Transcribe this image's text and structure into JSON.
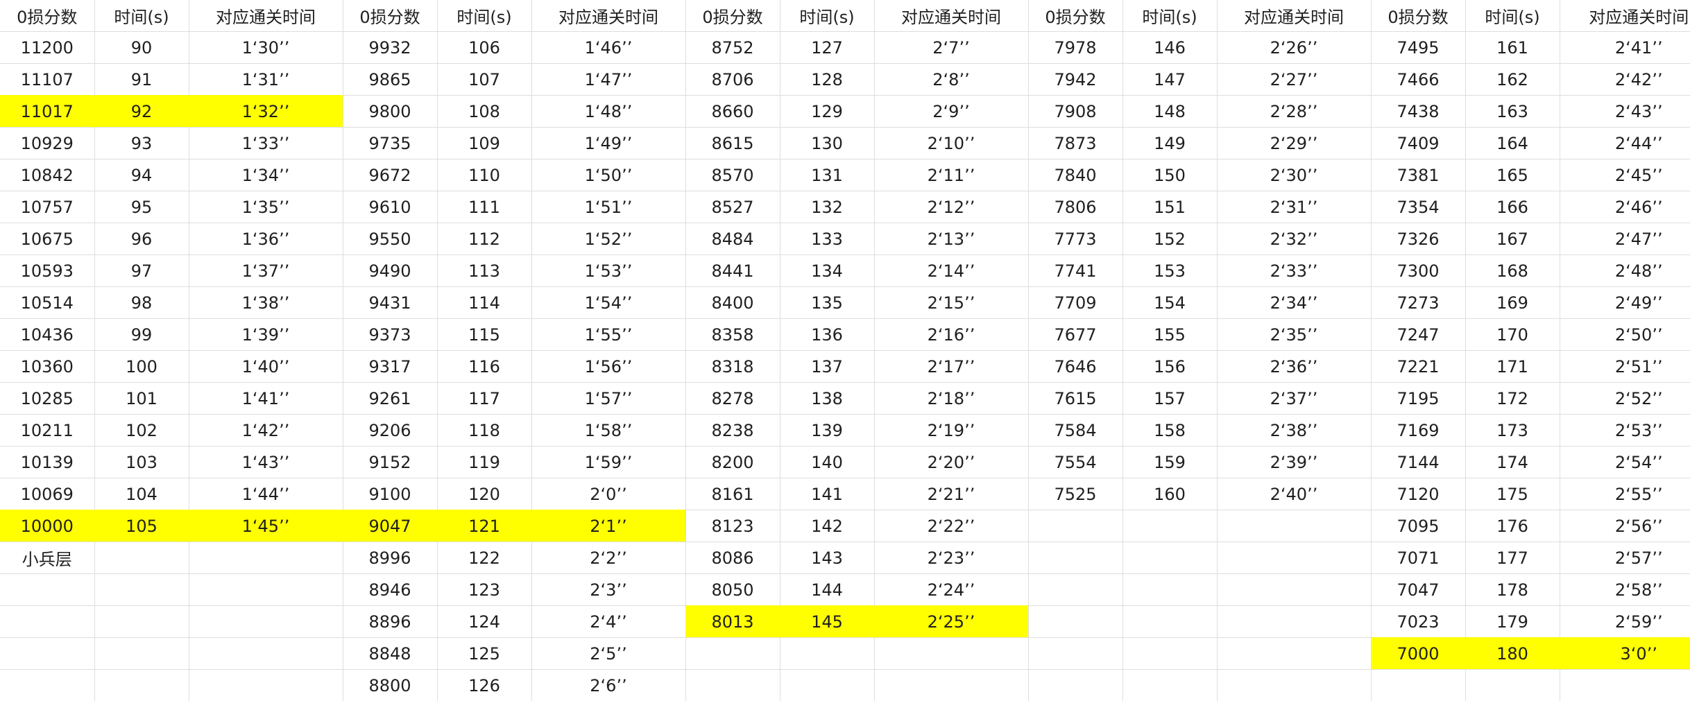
{
  "headers": [
    "0损分数",
    "时间(s)",
    "对应通关时间"
  ],
  "note": "小兵层",
  "highlight_color": "#ffff00",
  "groups": [
    {
      "highlighted_rows": [
        2,
        15
      ],
      "rows": [
        [
          "11200",
          "90",
          "1‘30’’"
        ],
        [
          "11107",
          "91",
          "1‘31’’"
        ],
        [
          "11017",
          "92",
          "1‘32’’"
        ],
        [
          "10929",
          "93",
          "1‘33’’"
        ],
        [
          "10842",
          "94",
          "1‘34’’"
        ],
        [
          "10757",
          "95",
          "1‘35’’"
        ],
        [
          "10675",
          "96",
          "1‘36’’"
        ],
        [
          "10593",
          "97",
          "1‘37’’"
        ],
        [
          "10514",
          "98",
          "1‘38’’"
        ],
        [
          "10436",
          "99",
          "1‘39’’"
        ],
        [
          "10360",
          "100",
          "1‘40’’"
        ],
        [
          "10285",
          "101",
          "1‘41’’"
        ],
        [
          "10211",
          "102",
          "1‘42’’"
        ],
        [
          "10139",
          "103",
          "1‘43’’"
        ],
        [
          "10069",
          "104",
          "1‘44’’"
        ],
        [
          "10000",
          "105",
          "1‘45’’"
        ]
      ]
    },
    {
      "highlighted_rows": [
        15
      ],
      "rows": [
        [
          "9932",
          "106",
          "1‘46’’"
        ],
        [
          "9865",
          "107",
          "1‘47’’"
        ],
        [
          "9800",
          "108",
          "1‘48’’"
        ],
        [
          "9735",
          "109",
          "1‘49’’"
        ],
        [
          "9672",
          "110",
          "1‘50’’"
        ],
        [
          "9610",
          "111",
          "1‘51’’"
        ],
        [
          "9550",
          "112",
          "1‘52’’"
        ],
        [
          "9490",
          "113",
          "1‘53’’"
        ],
        [
          "9431",
          "114",
          "1‘54’’"
        ],
        [
          "9373",
          "115",
          "1‘55’’"
        ],
        [
          "9317",
          "116",
          "1‘56’’"
        ],
        [
          "9261",
          "117",
          "1‘57’’"
        ],
        [
          "9206",
          "118",
          "1‘58’’"
        ],
        [
          "9152",
          "119",
          "1‘59’’"
        ],
        [
          "9100",
          "120",
          "2‘0’’"
        ],
        [
          "9047",
          "121",
          "2‘1’’"
        ],
        [
          "8996",
          "122",
          "2‘2’’"
        ],
        [
          "8946",
          "123",
          "2‘3’’"
        ],
        [
          "8896",
          "124",
          "2‘4’’"
        ],
        [
          "8848",
          "125",
          "2‘5’’"
        ],
        [
          "8800",
          "126",
          "2‘6’’"
        ]
      ]
    },
    {
      "highlighted_rows": [
        18
      ],
      "rows": [
        [
          "8752",
          "127",
          "2‘7’’"
        ],
        [
          "8706",
          "128",
          "2‘8’’"
        ],
        [
          "8660",
          "129",
          "2‘9’’"
        ],
        [
          "8615",
          "130",
          "2‘10’’"
        ],
        [
          "8570",
          "131",
          "2‘11’’"
        ],
        [
          "8527",
          "132",
          "2‘12’’"
        ],
        [
          "8484",
          "133",
          "2‘13’’"
        ],
        [
          "8441",
          "134",
          "2‘14’’"
        ],
        [
          "8400",
          "135",
          "2‘15’’"
        ],
        [
          "8358",
          "136",
          "2‘16’’"
        ],
        [
          "8318",
          "137",
          "2‘17’’"
        ],
        [
          "8278",
          "138",
          "2‘18’’"
        ],
        [
          "8238",
          "139",
          "2‘19’’"
        ],
        [
          "8200",
          "140",
          "2‘20’’"
        ],
        [
          "8161",
          "141",
          "2‘21’’"
        ],
        [
          "8123",
          "142",
          "2‘22’’"
        ],
        [
          "8086",
          "143",
          "2‘23’’"
        ],
        [
          "8050",
          "144",
          "2‘24’’"
        ],
        [
          "8013",
          "145",
          "2‘25’’"
        ]
      ]
    },
    {
      "highlighted_rows": [],
      "rows": [
        [
          "7978",
          "146",
          "2‘26’’"
        ],
        [
          "7942",
          "147",
          "2‘27’’"
        ],
        [
          "7908",
          "148",
          "2‘28’’"
        ],
        [
          "7873",
          "149",
          "2‘29’’"
        ],
        [
          "7840",
          "150",
          "2‘30’’"
        ],
        [
          "7806",
          "151",
          "2‘31’’"
        ],
        [
          "7773",
          "152",
          "2‘32’’"
        ],
        [
          "7741",
          "153",
          "2‘33’’"
        ],
        [
          "7709",
          "154",
          "2‘34’’"
        ],
        [
          "7677",
          "155",
          "2‘35’’"
        ],
        [
          "7646",
          "156",
          "2‘36’’"
        ],
        [
          "7615",
          "157",
          "2‘37’’"
        ],
        [
          "7584",
          "158",
          "2‘38’’"
        ],
        [
          "7554",
          "159",
          "2‘39’’"
        ],
        [
          "7525",
          "160",
          "2‘40’’"
        ]
      ]
    },
    {
      "highlighted_rows": [
        19
      ],
      "rows": [
        [
          "7495",
          "161",
          "2‘41’’"
        ],
        [
          "7466",
          "162",
          "2‘42’’"
        ],
        [
          "7438",
          "163",
          "2‘43’’"
        ],
        [
          "7409",
          "164",
          "2‘44’’"
        ],
        [
          "7381",
          "165",
          "2‘45’’"
        ],
        [
          "7354",
          "166",
          "2‘46’’"
        ],
        [
          "7326",
          "167",
          "2‘47’’"
        ],
        [
          "7300",
          "168",
          "2‘48’’"
        ],
        [
          "7273",
          "169",
          "2‘49’’"
        ],
        [
          "7247",
          "170",
          "2‘50’’"
        ],
        [
          "7221",
          "171",
          "2‘51’’"
        ],
        [
          "7195",
          "172",
          "2‘52’’"
        ],
        [
          "7169",
          "173",
          "2‘53’’"
        ],
        [
          "7144",
          "174",
          "2‘54’’"
        ],
        [
          "7120",
          "175",
          "2‘55’’"
        ],
        [
          "7095",
          "176",
          "2‘56’’"
        ],
        [
          "7071",
          "177",
          "2‘57’’"
        ],
        [
          "7047",
          "178",
          "2‘58’’"
        ],
        [
          "7023",
          "179",
          "2‘59’’"
        ],
        [
          "7000",
          "180",
          "3‘0’’"
        ]
      ]
    }
  ]
}
